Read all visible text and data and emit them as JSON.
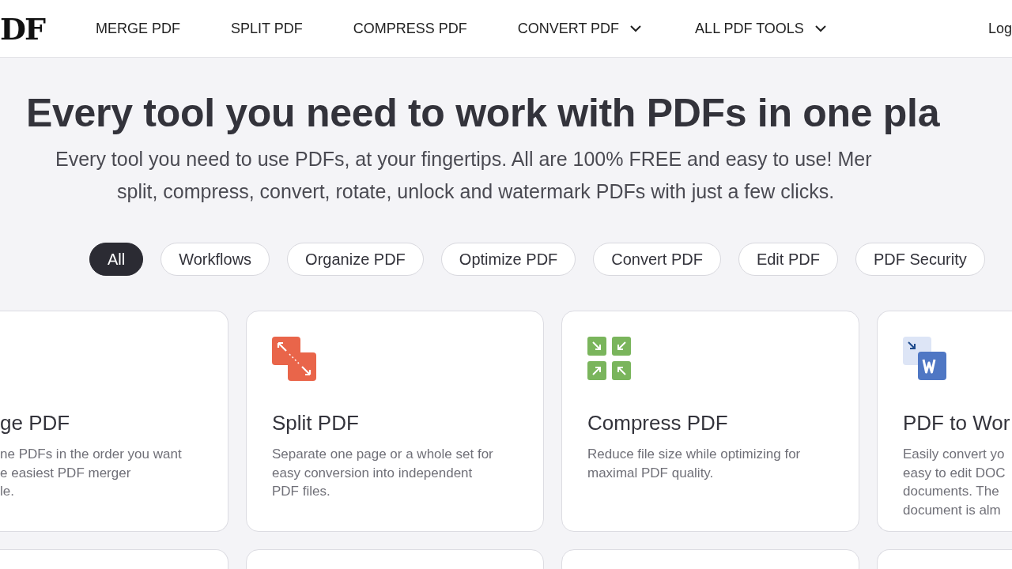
{
  "header": {
    "logo": "DF",
    "nav": [
      {
        "label": "MERGE PDF",
        "dropdown": false
      },
      {
        "label": "SPLIT PDF",
        "dropdown": false
      },
      {
        "label": "COMPRESS PDF",
        "dropdown": false
      },
      {
        "label": "CONVERT PDF",
        "dropdown": true
      },
      {
        "label": "ALL PDF TOOLS",
        "dropdown": true
      }
    ],
    "login": "Log"
  },
  "hero": {
    "title": "Every tool you need to work with PDFs in one pla",
    "subtitle_lines": [
      "Every tool you need to use PDFs, at your fingertips. All are 100% FREE and easy to use! Mer",
      "split, compress, convert, rotate, unlock and watermark PDFs with just a few clicks."
    ]
  },
  "filters": [
    {
      "label": "All",
      "selected": true
    },
    {
      "label": "Workflows",
      "selected": false
    },
    {
      "label": "Organize PDF",
      "selected": false
    },
    {
      "label": "Optimize PDF",
      "selected": false
    },
    {
      "label": "Convert PDF",
      "selected": false
    },
    {
      "label": "Edit PDF",
      "selected": false
    },
    {
      "label": "PDF Security",
      "selected": false
    }
  ],
  "tools": [
    {
      "kind": "merge",
      "title": "ge PDF",
      "description": [
        "ne PDFs in the order you want",
        "e easiest PDF merger",
        "le."
      ]
    },
    {
      "kind": "split",
      "title": "Split PDF",
      "description": [
        "Separate one page or a whole set for",
        "easy conversion into independent",
        "PDF files."
      ]
    },
    {
      "kind": "compress",
      "title": "Compress PDF",
      "description": [
        "Reduce file size while optimizing for",
        "maximal PDF quality."
      ]
    },
    {
      "kind": "word",
      "title": "PDF to Wor",
      "description": [
        "Easily convert yo",
        "easy to edit DOC",
        "documents. The",
        "document is alm"
      ]
    }
  ]
}
